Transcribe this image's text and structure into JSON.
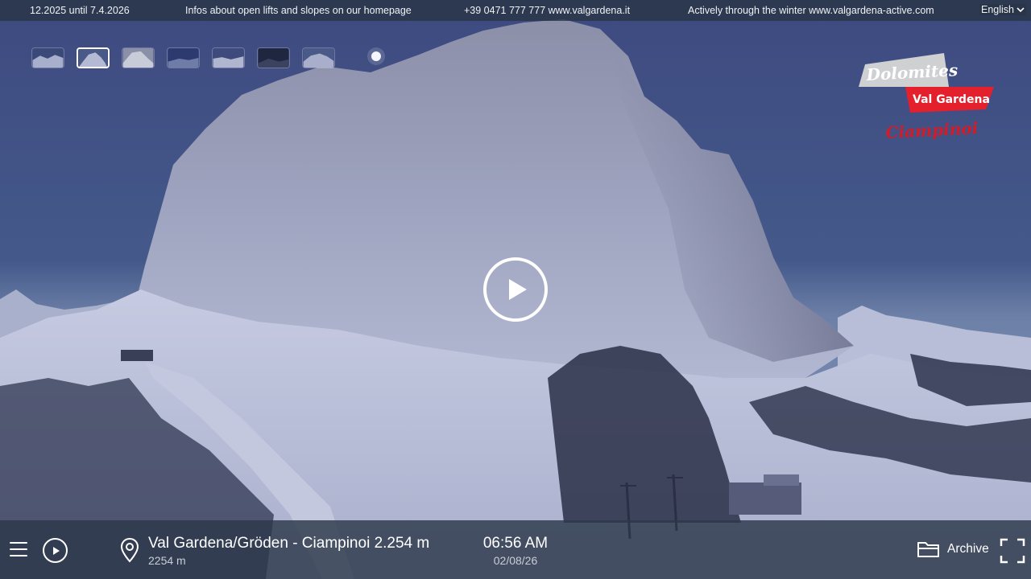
{
  "ticker": {
    "item1": "12.2025 until 7.4.2026",
    "item2": "Infos about open lifts and slopes on our homepage",
    "item3": "+39 0471 777 777 www.valgardena.it",
    "item4": "Actively through the winter www.valgardena-active.com",
    "language": "English"
  },
  "thumbnails": {
    "count": 7,
    "active_index": 1
  },
  "logo": {
    "line1": "Dolomites",
    "line2": "Val Gardena",
    "line3": "Ciampinoi",
    "colors": {
      "red": "#e3202b",
      "gray": "#c8c8c8"
    }
  },
  "player": {
    "play_icon": "play-icon"
  },
  "bottombar": {
    "location_title": "Val Gardena/Gröden - Ciampinoi 2.254 m",
    "altitude": "2254 m",
    "time": "06:56 AM",
    "date": "02/08/26",
    "archive_label": "Archive"
  }
}
